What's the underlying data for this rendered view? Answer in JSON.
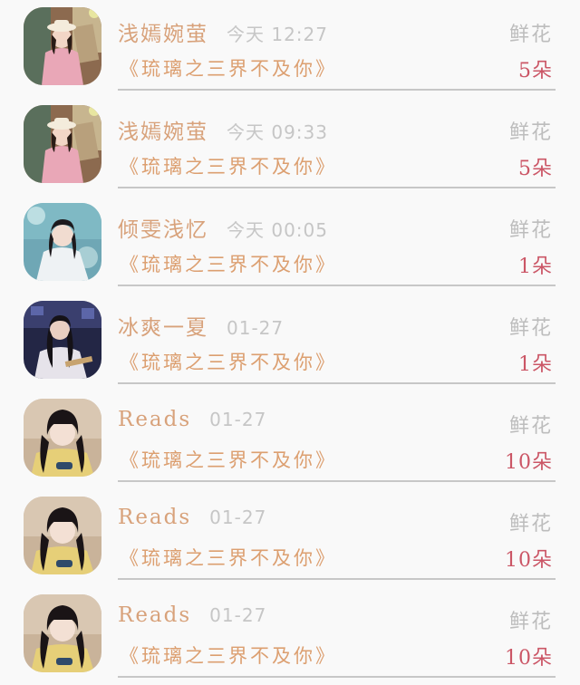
{
  "colors": {
    "name": "#d8a27b",
    "time": "#c6c6c6",
    "book": "#dc9f70",
    "count": "#cb5666",
    "gift_label": "#bdbdbd",
    "divider": "#c7c7c7",
    "background": "#f9f9f9"
  },
  "records": [
    {
      "avatar_icon": "avatar-pink-girl-photo",
      "name": "浅嫣婉萤",
      "time": "今天 12:27",
      "gift_label": "鲜花",
      "book": "《琉璃之三界不及你》",
      "count": "5朵"
    },
    {
      "avatar_icon": "avatar-pink-girl-photo",
      "name": "浅嫣婉萤",
      "time": "今天 09:33",
      "gift_label": "鲜花",
      "book": "《琉璃之三界不及你》",
      "count": "5朵"
    },
    {
      "avatar_icon": "avatar-white-robed-man",
      "name": "倾雯浅忆",
      "time": "今天 00:05",
      "gift_label": "鲜花",
      "book": "《琉璃之三界不及你》",
      "count": "1朵"
    },
    {
      "avatar_icon": "avatar-costume-man-dark",
      "name": "冰爽一夏",
      "time": "01-27",
      "gift_label": "鲜花",
      "book": "《琉璃之三界不及你》",
      "count": "1朵"
    },
    {
      "avatar_icon": "avatar-girl-yellow-sweater",
      "name": "Reads",
      "time": "01-27",
      "gift_label": "鲜花",
      "book": "《琉璃之三界不及你》",
      "count": "10朵"
    },
    {
      "avatar_icon": "avatar-girl-yellow-sweater",
      "name": "Reads",
      "time": "01-27",
      "gift_label": "鲜花",
      "book": "《琉璃之三界不及你》",
      "count": "10朵"
    },
    {
      "avatar_icon": "avatar-girl-yellow-sweater",
      "name": "Reads",
      "time": "01-27",
      "gift_label": "鲜花",
      "book": "《琉璃之三界不及你》",
      "count": "10朵"
    }
  ]
}
